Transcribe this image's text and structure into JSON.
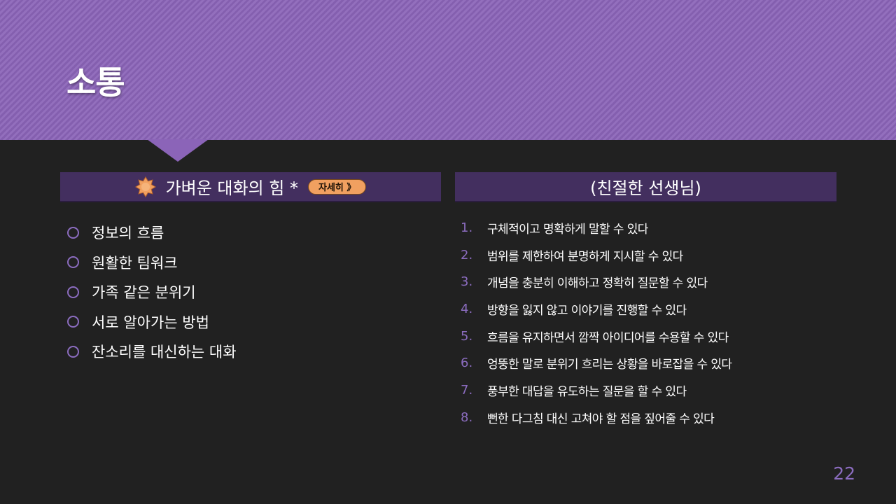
{
  "slide": {
    "title": "소통",
    "page_number": "22"
  },
  "left_panel": {
    "header": "가벼운 대화의 힘 *",
    "icon": "star-burst-icon",
    "detail_button": "자세히 》",
    "bullets": [
      "정보의 흐름",
      "원활한 팀워크",
      "가족 같은 분위기",
      "서로 알아가는 방법",
      "잔소리를 대신하는 대화"
    ]
  },
  "right_panel": {
    "header": "(친절한 선생님)",
    "items": [
      {
        "num": "1.",
        "text": "구체적이고 명확하게 말할 수 있다"
      },
      {
        "num": "2.",
        "text": "범위를 제한하여 분명하게 지시할 수 있다"
      },
      {
        "num": "3.",
        "text": "개념을 충분히 이해하고 정확히 질문할 수 있다"
      },
      {
        "num": "4.",
        "text": "방향을 잃지 않고 이야기를 진행할 수 있다"
      },
      {
        "num": "5.",
        "text": "흐름을 유지하면서 깜짝 아이디어를  수용할 수 있다"
      },
      {
        "num": "6.",
        "text": "엉뚱한 말로 분위기 흐리는 상황을  바로잡을 수 있다"
      },
      {
        "num": "7.",
        "text": "풍부한 대답을 유도하는 질문을 할 수 있다"
      },
      {
        "num": "8.",
        "text": "뻔한 다그침 대신 고쳐야 할 점을 짚어줄 수 있다"
      }
    ]
  },
  "colors": {
    "banner": "#8b64b8",
    "header_bar": "#432f5f",
    "accent": "#8b6cbf",
    "button": "#f1a060",
    "background": "#212121"
  }
}
